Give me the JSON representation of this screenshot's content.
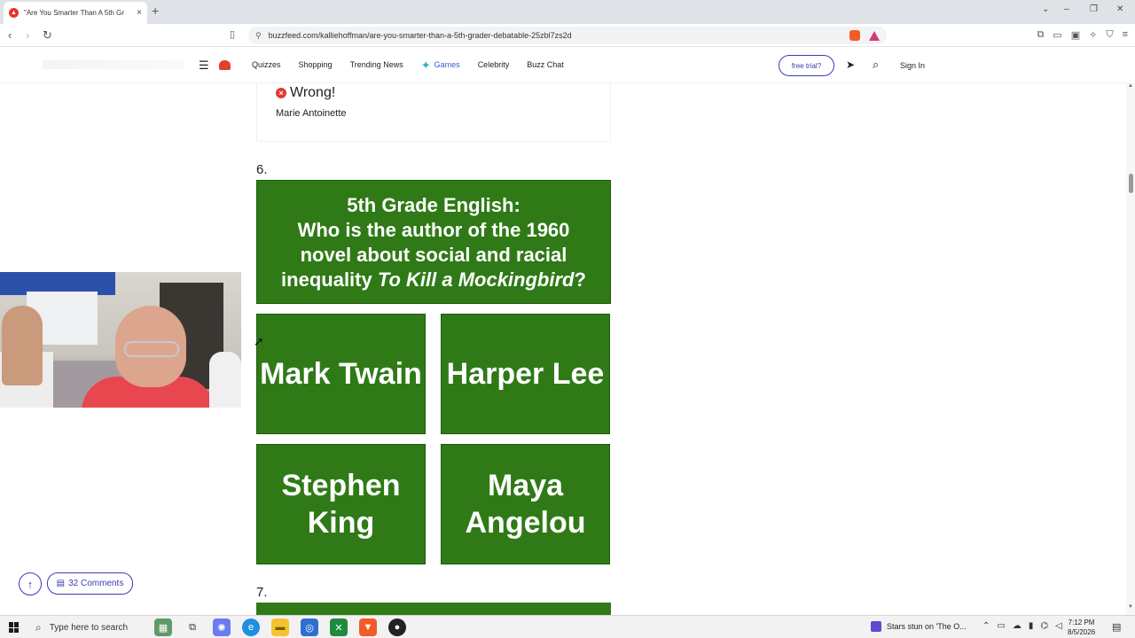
{
  "browser": {
    "tab_title": "\"Are You Smarter Than A 5th Gr",
    "tab_close": "×",
    "new_tab": "+",
    "url": "buzzfeed.com/kalliehoffman/are-you-smarter-than-a-5th-grader-debatable-25zbl7zs2d"
  },
  "site_nav": {
    "links": {
      "quizzes": "Quizzes",
      "shopping": "Shopping",
      "trending": "Trending News",
      "games": "Games",
      "celebrity": "Celebrity",
      "buzz_chat": "Buzz Chat"
    },
    "free_trial": "free trial?",
    "sign_in": "Sign In"
  },
  "previous": {
    "result": "Wrong!",
    "answer": "Marie Antoinette"
  },
  "question6": {
    "number": "6.",
    "line1": "5th Grade English:",
    "line2": "Who is the author of the 1960",
    "line3": "novel about social and racial",
    "line4_prefix": "inequality ",
    "line4_title": "To Kill a Mockingbird",
    "line4_suffix": "?",
    "options": [
      "Mark Twain",
      "Harper Lee",
      "Stephen King",
      "Maya Angelou"
    ]
  },
  "question7": {
    "number": "7."
  },
  "floating": {
    "comments": "32 Comments"
  },
  "taskbar": {
    "search_placeholder": "Type here to search",
    "news": "Stars stun on 'The O...",
    "time": "7:12 PM",
    "date": "8/5/2026"
  },
  "colors": {
    "answer_green": "#2f7a17",
    "accent_blue": "#3b3bb4",
    "wrong_red": "#e23b2e"
  }
}
